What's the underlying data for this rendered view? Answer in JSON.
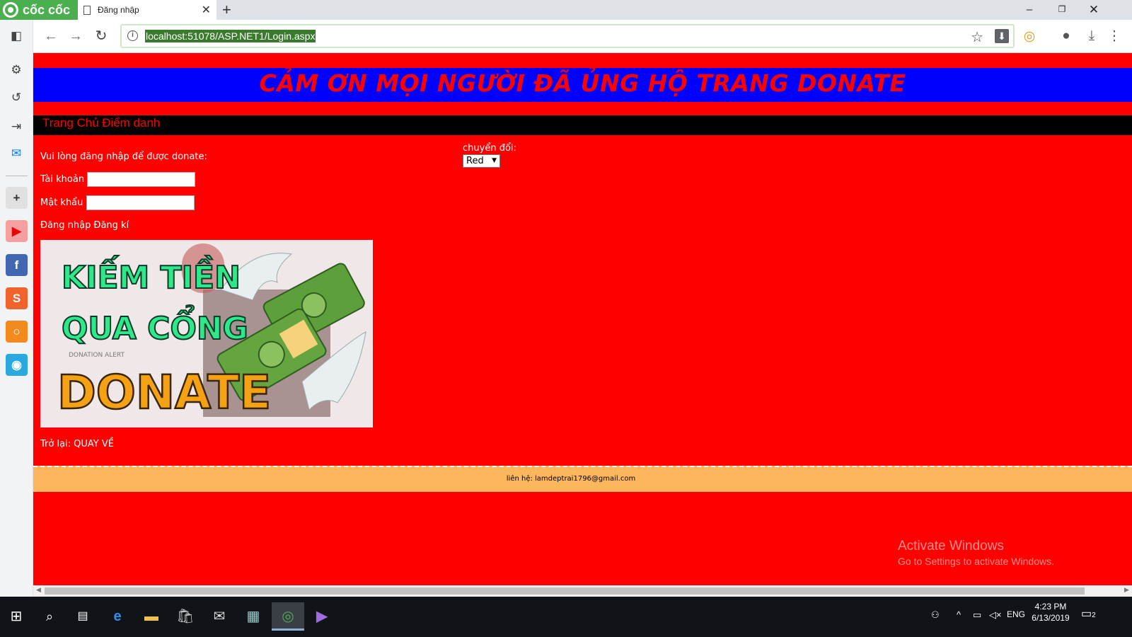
{
  "browser": {
    "brand": "cốc cốc",
    "tab_title": "Đăng nhập",
    "new_tab": "+",
    "url": "localhost:51078/ASP.NET1/Login.aspx"
  },
  "page": {
    "banner": "CẢM ƠN MỌI NGƯỜI ĐÃ ỦNG HỘ TRANG DONATE",
    "nav": {
      "home": "Trang Chủ",
      "attendance": "Điểm danh"
    },
    "login_prompt": "Vui lòng đăng nhập để được donate:",
    "username_label": "Tài khoản",
    "password_label": "Mật khẩu",
    "login_link": "Đăng nhập",
    "register_link": "Đăng kí",
    "image": {
      "line1": "KIẾM TIỀN",
      "line2": "QUA CỔNG",
      "line3": "DONATE",
      "small": "DONATION ALERT"
    },
    "back_label": "Trở lại:",
    "back_link": "QUAY VỀ",
    "switch_label": "chuyển đổi:",
    "switch_value": "Red",
    "footer": "liên hệ: lamdeptrai1796@gmail.com"
  },
  "watermark": {
    "title": "Activate Windows",
    "subtitle": "Go to Settings to activate Windows."
  },
  "taskbar": {
    "lang": "ENG",
    "time": "4:23 PM",
    "date": "6/13/2019",
    "notifications": "2"
  },
  "colors": {
    "page_bg": "#ff0000",
    "banner_bg": "#0000ff",
    "nav_bg": "#000000",
    "footer_bg": "#fcb75c",
    "brand_green": "#4bae4f"
  }
}
